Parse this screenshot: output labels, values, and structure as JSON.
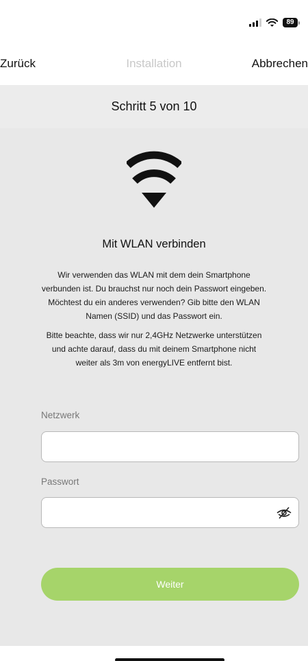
{
  "status_bar": {
    "battery_level": "89",
    "cellular_icon": "cellular-signal-icon",
    "wifi_icon": "wifi-status-icon"
  },
  "nav": {
    "back_label": "Zurück",
    "title": "Installation",
    "cancel_label": "Abbrechen"
  },
  "step": {
    "label": "Schritt 5 von 10"
  },
  "content": {
    "icon": "wifi-icon",
    "heading": "Mit WLAN verbinden",
    "paragraph1": "Wir verwenden das WLAN mit dem dein Smartphone verbunden ist. Du brauchst nur noch dein Passwort eingeben. Möchtest du ein anderes verwenden? Gib bitte den WLAN Namen (SSID) und das Passwort ein.",
    "paragraph2": "Bitte beachte, dass wir nur 2,4GHz Netzwerke unterstützen und achte darauf, dass du mit deinem Smartphone nicht weiter als 3m von energyLIVE entfernt bist."
  },
  "form": {
    "network_label": "Netzwerk",
    "network_value": "",
    "password_label": "Passwort",
    "password_value": "",
    "visibility_icon": "eye-slash-icon",
    "submit_label": "Weiter"
  },
  "colors": {
    "accent": "#a6d46a",
    "background": "#e8e8e8",
    "step_banner": "#ececec",
    "nav_title": "#c8c8c8"
  }
}
